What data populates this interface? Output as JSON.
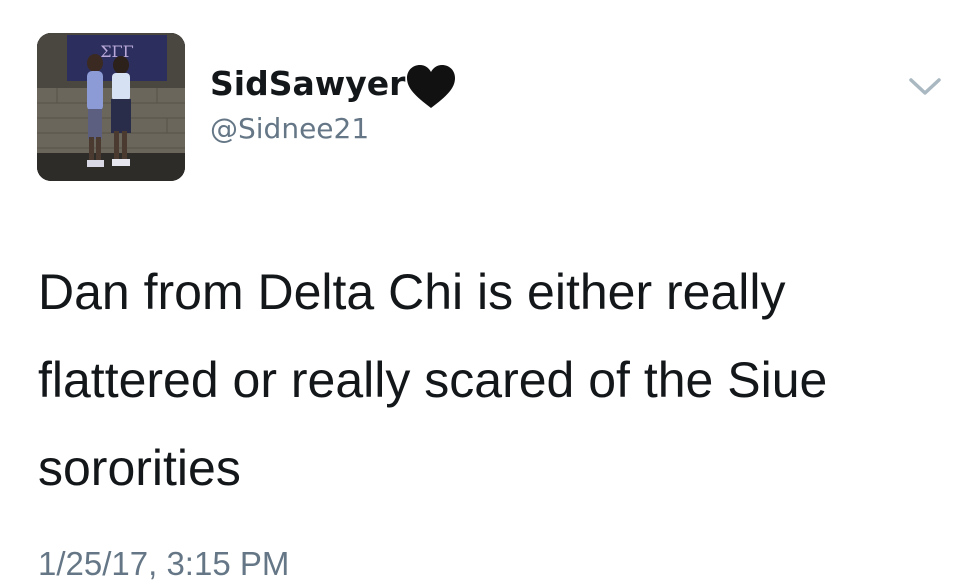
{
  "tweet": {
    "author": {
      "display_name": "SidSawyer",
      "emoji": "black-heart",
      "handle": "@Sidnee21",
      "avatar_icon": "profile-photo"
    },
    "menu_icon": "chevron-down-icon",
    "text": "Dan from Delta Chi is either really flattered or really scared of the Siue sororities",
    "timestamp": "1/25/17, 3:15 PM"
  },
  "colors": {
    "text": "#14171a",
    "secondary_text": "#657786",
    "chevron": "#aab8c2",
    "background": "#ffffff"
  }
}
